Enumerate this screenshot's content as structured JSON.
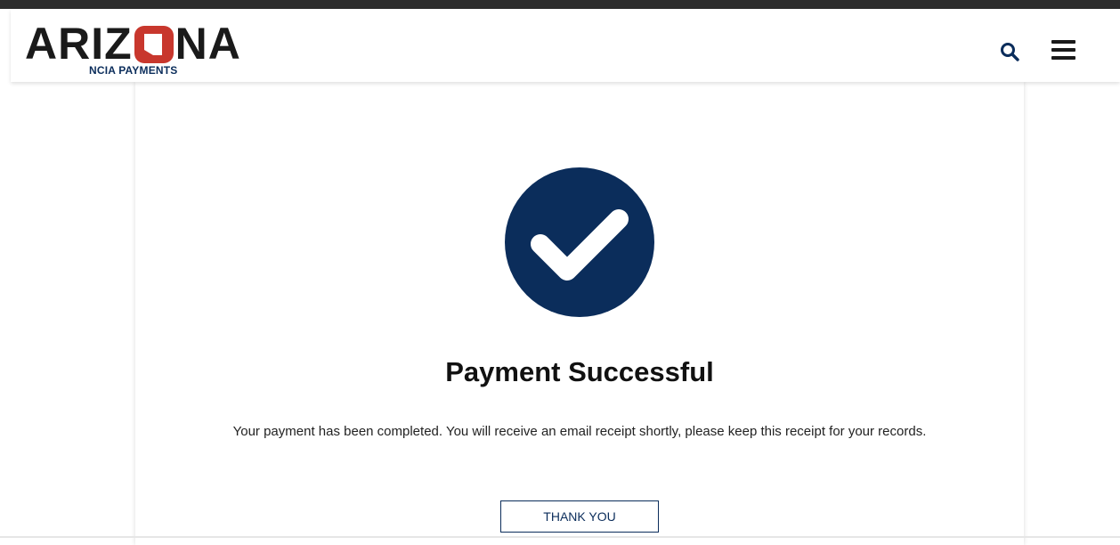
{
  "header": {
    "logo_left": "ARIZ",
    "logo_right": "NA",
    "logo_sub": "NCIA PAYMENTS"
  },
  "colors": {
    "navy": "#0b2d5b",
    "badge_red": "#c8372d"
  },
  "icons": {
    "search": "search-icon",
    "menu": "hamburger-menu-icon",
    "success": "checkmark-circle-icon"
  },
  "main": {
    "title": "Payment Successful",
    "message": "Your payment has been completed. You will receive an email receipt shortly, please keep this receipt for your records.",
    "button_label": "THANK YOU"
  }
}
